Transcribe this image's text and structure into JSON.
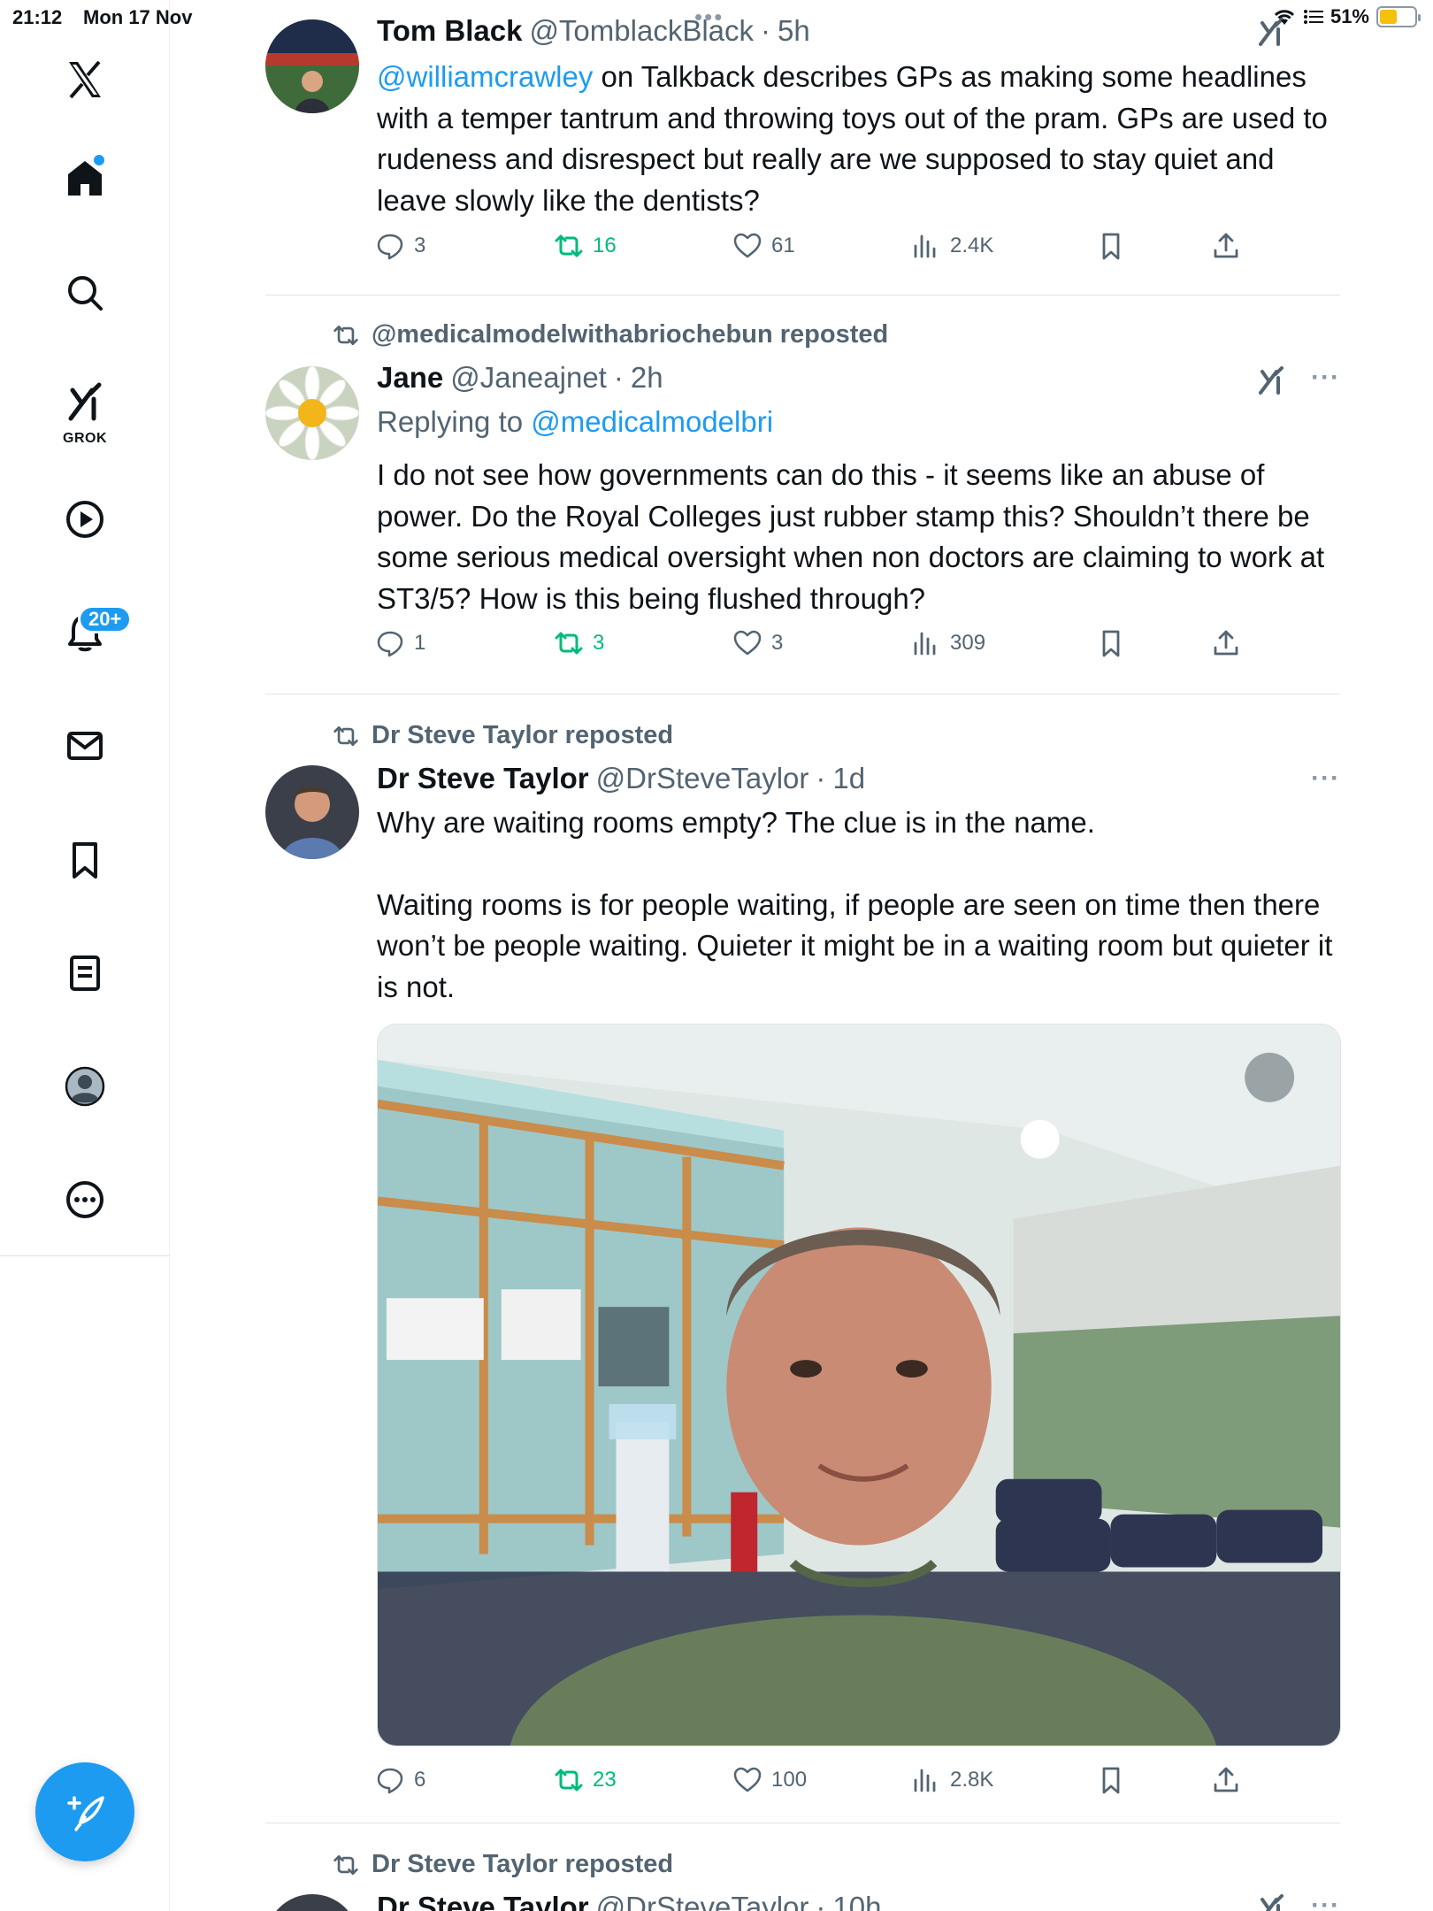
{
  "status_bar": {
    "time": "21:12",
    "date": "Mon 17 Nov",
    "battery_percent": "51%",
    "battery_level": 0.51
  },
  "sidebar": {
    "items": [
      {
        "icon": "x-logo-icon"
      },
      {
        "icon": "home-icon"
      },
      {
        "icon": "search-icon"
      },
      {
        "icon": "grok-icon",
        "label": "GROK"
      },
      {
        "icon": "video-icon"
      },
      {
        "icon": "notifications-icon",
        "badge": "20+"
      },
      {
        "icon": "messages-icon"
      },
      {
        "icon": "bookmarks-icon"
      },
      {
        "icon": "lists-icon"
      },
      {
        "icon": "profile-icon"
      },
      {
        "icon": "more-icon"
      }
    ],
    "compose_icon": "compose-icon"
  },
  "colors": {
    "accent": "#1d9bf0",
    "retweet_green": "#00ba7c",
    "secondary_text": "#536471"
  },
  "tweets": [
    {
      "name": "Tom Black",
      "handle": "@TomblackBlack",
      "sep": "·",
      "time": "5h",
      "mention": "@williamcrawley",
      "text": " on Talkback describes GPs as making some headlines with a temper tantrum and throwing toys out of the pram. GPs are used to rudeness and disrespect but really are we supposed to stay quiet and leave slowly like the dentists?",
      "more": "···",
      "replies": "3",
      "retweets": "16",
      "likes": "61",
      "views": "2.4K"
    },
    {
      "reposted_by": "@medicalmodelwithabriochebun reposted",
      "name": "Jane",
      "handle": "@Janeajnet",
      "sep": "·",
      "time": "2h",
      "replying_prefix": "Replying to ",
      "replying_to": "@medicalmodelbri",
      "text": "I do not see how governments can do this - it seems like an abuse of power. Do the Royal Colleges just rubber stamp this? Shouldn’t there be some serious medical oversight when non doctors are claiming to work at ST3/5? How is this being flushed through?",
      "more": "···",
      "replies": "1",
      "retweets": "3",
      "likes": "3",
      "views": "309"
    },
    {
      "reposted_by": "Dr Steve Taylor reposted",
      "name": "Dr Steve Taylor",
      "handle": "@DrSteveTaylor",
      "sep": "·",
      "time": "1d",
      "text_p1": "Why are waiting rooms empty? The clue is in the name.",
      "text_p2": "Waiting rooms is for people waiting, if people are seen on time then there won’t be people waiting. Quieter it might be in a waiting room but quieter it is not.",
      "more": "···",
      "replies": "6",
      "retweets": "23",
      "likes": "100",
      "views": "2.8K"
    },
    {
      "reposted_by": "Dr Steve Taylor reposted",
      "name": "Dr Steve Taylor",
      "handle": "@DrSteveTaylor",
      "sep": "·",
      "time": "10h",
      "more": "···"
    }
  ]
}
